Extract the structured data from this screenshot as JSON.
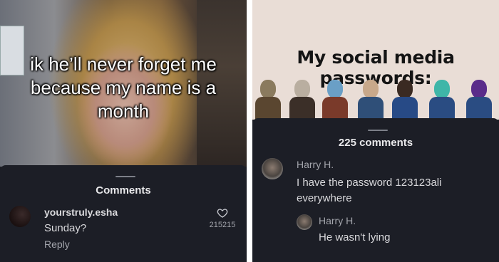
{
  "left_post": {
    "caption": "ik he’ll never forget me because my name is a month",
    "comments_title": "Comments",
    "comment": {
      "username": "yourstruly.esha",
      "text": "Sunday?",
      "reply_label": "Reply",
      "likes": "215215"
    }
  },
  "right_post": {
    "meme_title": "My social media passwords:",
    "comments_title": "225 comments",
    "comment": {
      "username": "Harry H.",
      "text": "I have the password 123123ali everywhere"
    },
    "reply": {
      "username": "Harry H.",
      "text": "He wasn't lying"
    }
  },
  "colors": {
    "sheet_background": "#1c1e26",
    "meme_background": "#e9ddd6"
  }
}
